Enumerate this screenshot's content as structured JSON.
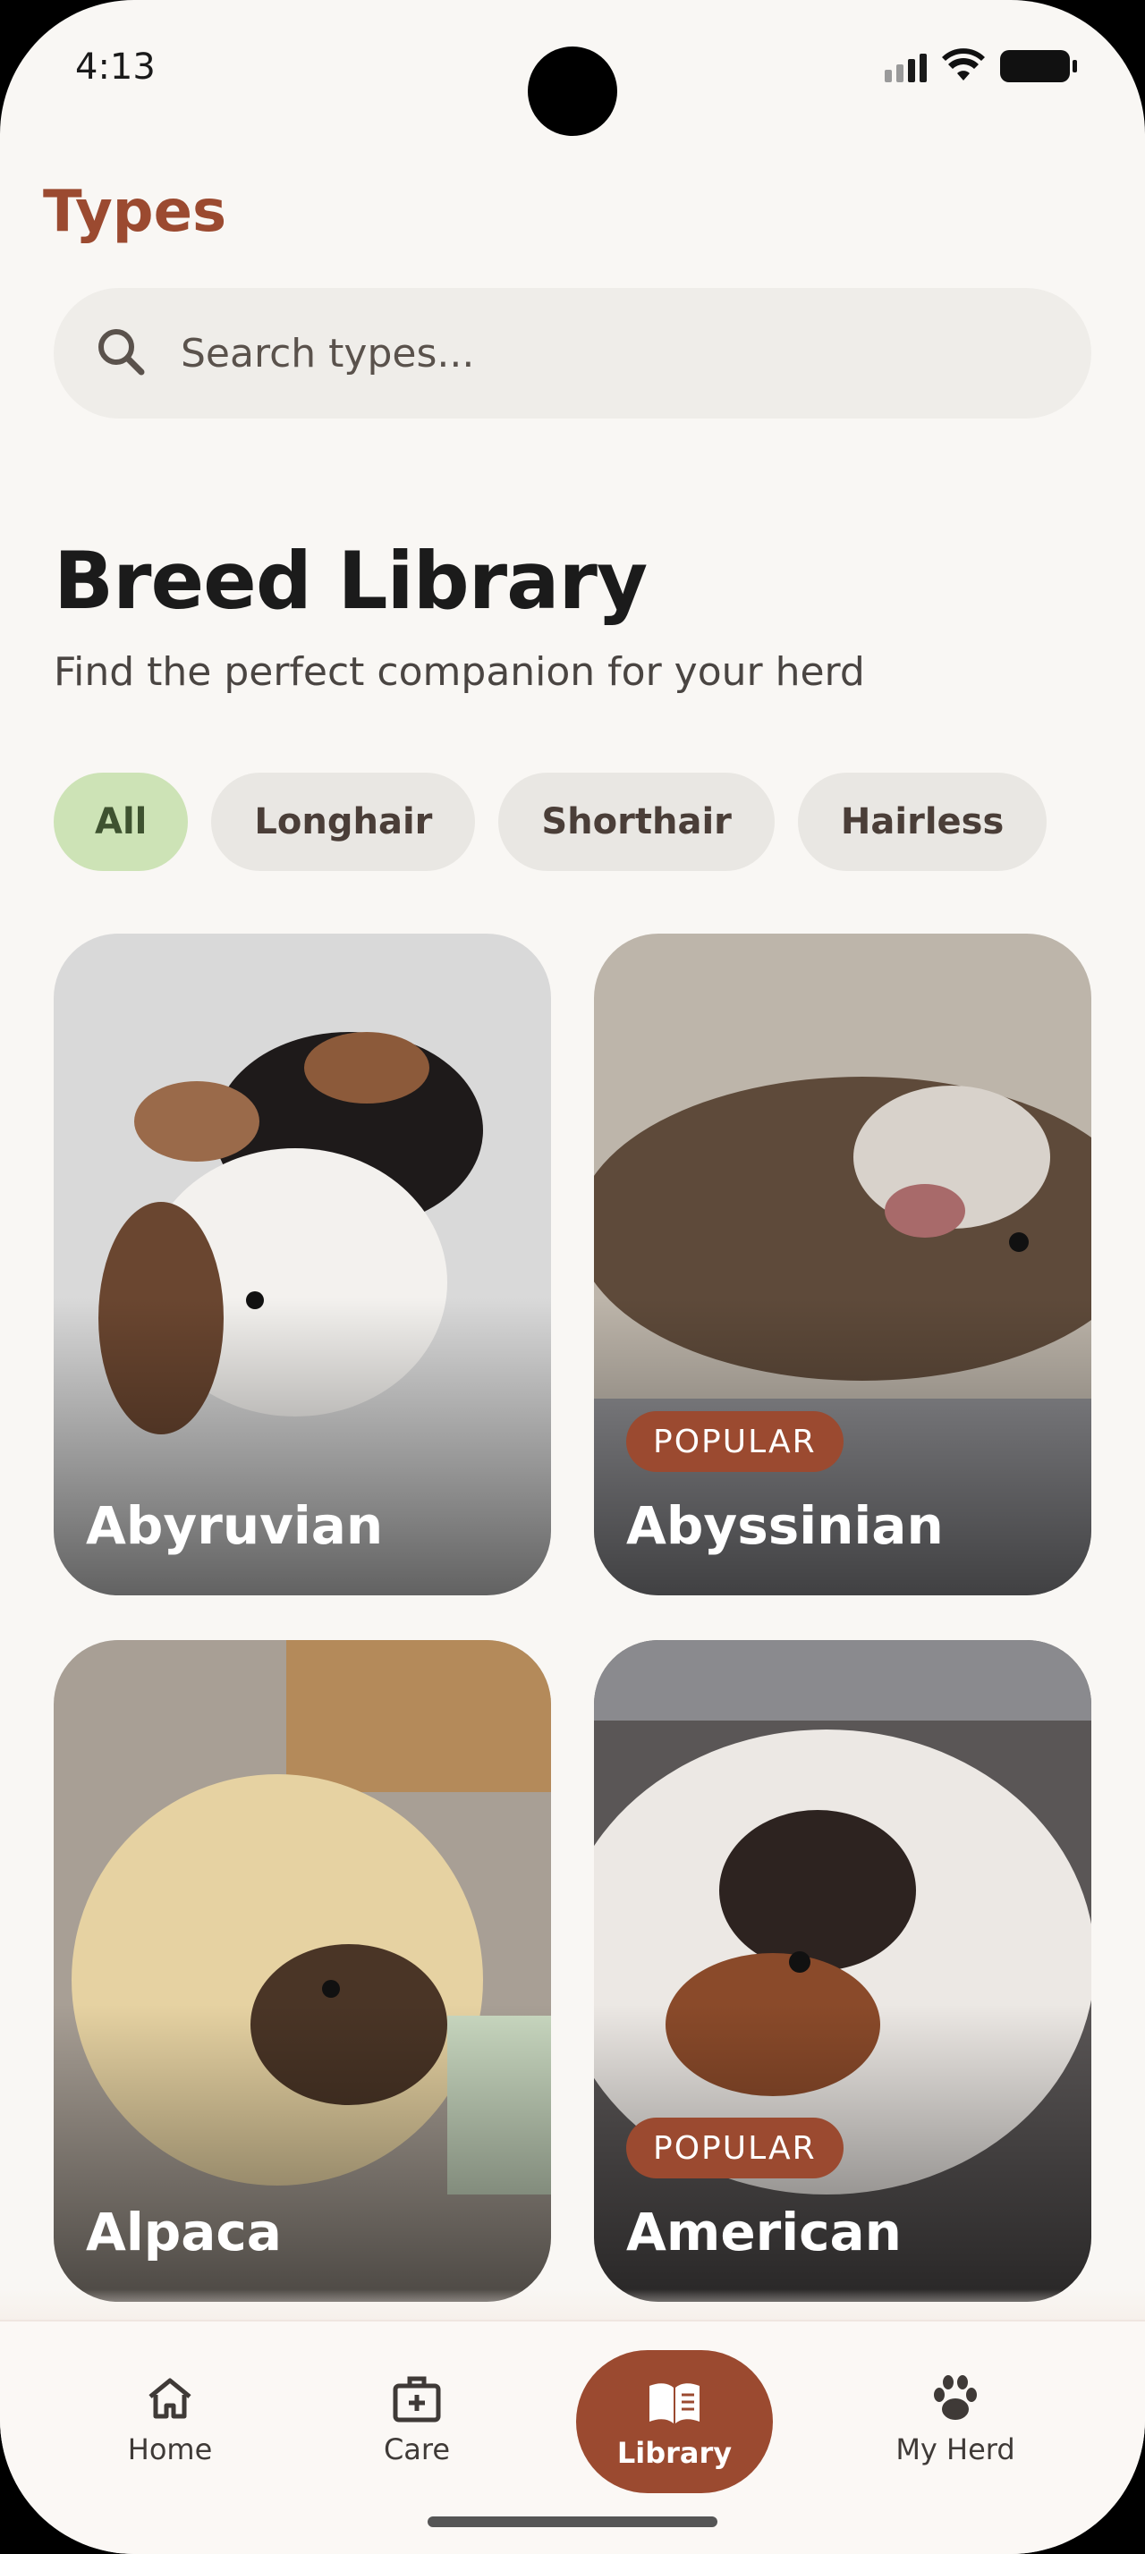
{
  "status_bar": {
    "time": "4:13"
  },
  "header": {
    "title": "Types"
  },
  "search": {
    "placeholder": "Search types..."
  },
  "section": {
    "title": "Breed Library",
    "subtitle": "Find the perfect companion for your herd"
  },
  "filters": {
    "chips": [
      {
        "label": "All",
        "selected": true
      },
      {
        "label": "Longhair",
        "selected": false
      },
      {
        "label": "Shorthair",
        "selected": false
      },
      {
        "label": "Hairless",
        "selected": false
      }
    ]
  },
  "breeds": [
    {
      "name": "Abyruvian",
      "badge": ""
    },
    {
      "name": "Abyssinian",
      "badge": "POPULAR"
    },
    {
      "name": "Alpaca",
      "badge": ""
    },
    {
      "name": "American",
      "badge": "POPULAR"
    }
  ],
  "bottom_nav": {
    "items": [
      {
        "label": "Home",
        "icon": "home-icon"
      },
      {
        "label": "Care",
        "icon": "medical-kit-icon"
      },
      {
        "label": "Library",
        "icon": "book-icon",
        "active": true
      },
      {
        "label": "My Herd",
        "icon": "paw-icon"
      }
    ]
  },
  "colors": {
    "accent": "#9b4a30",
    "chip_active": "#cde3b6",
    "background": "#f9f7f4"
  }
}
